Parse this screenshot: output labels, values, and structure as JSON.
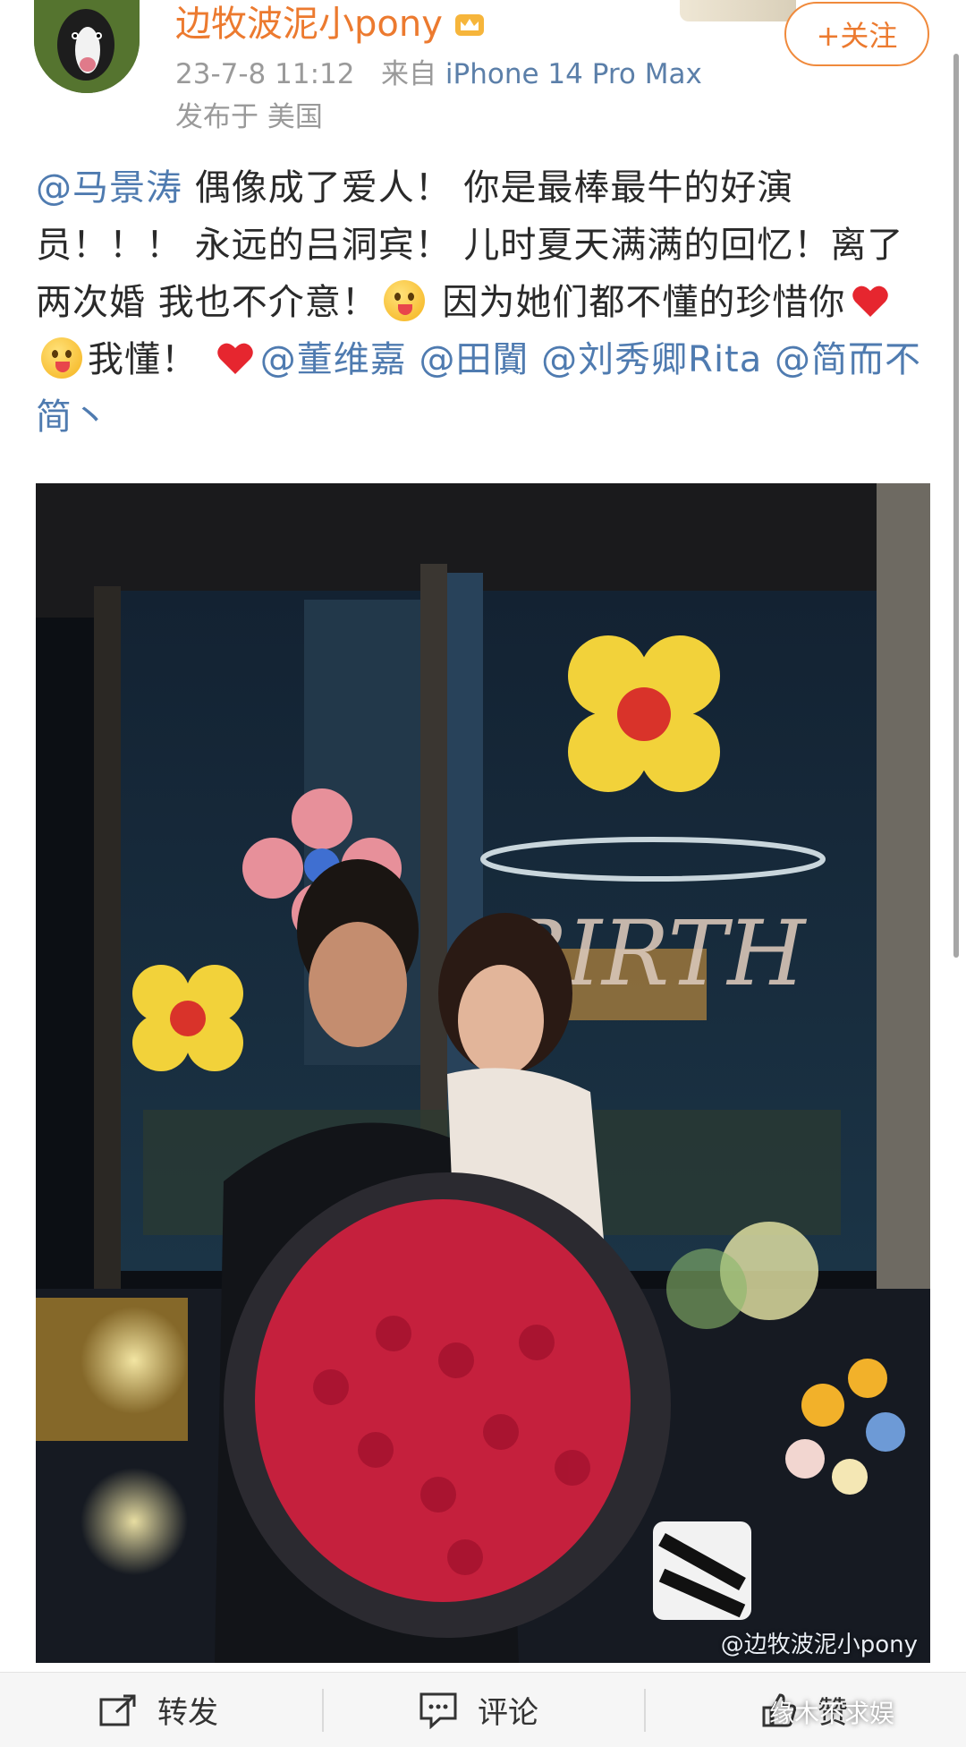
{
  "header": {
    "username": "边牧波泥小pony",
    "timestamp": "23-7-8 11:12",
    "source_prefix": "来自",
    "device": "iPhone 14 Pro Max",
    "location": "发布于 美国",
    "follow_label": "+关注",
    "crown_icon": "vip-crown-icon"
  },
  "post": {
    "segments": [
      {
        "type": "mention",
        "text": "@马景涛"
      },
      {
        "type": "text",
        "text": " 偶像成了爱人！ 你是最棒最牛的好演员！！！ 永远的吕洞宾！ 儿时夏天满满的回忆！离了两次婚 我也不介意！"
      },
      {
        "type": "emoji",
        "name": "tongue-wink-emoji"
      },
      {
        "type": "text",
        "text": " 因为她们都不懂的珍惜你"
      },
      {
        "type": "heart",
        "name": "red-heart-emoji"
      },
      {
        "type": "emoji",
        "name": "tongue-wink-emoji"
      },
      {
        "type": "text",
        "text": "我懂！ "
      },
      {
        "type": "heart",
        "name": "red-heart-emoji"
      },
      {
        "type": "mention",
        "text": "@董维嘉"
      },
      {
        "type": "text",
        "text": " "
      },
      {
        "type": "mention",
        "text": "@田闐"
      },
      {
        "type": "text",
        "text": " "
      },
      {
        "type": "mention",
        "text": "@刘秀卿Rita"
      },
      {
        "type": "text",
        "text": " "
      },
      {
        "type": "mention",
        "text": "@简而不简丶"
      }
    ]
  },
  "photo": {
    "watermark": "@边牧波泥小pony",
    "balloon_letters": "BIRTH"
  },
  "actions": {
    "repost_label": "转发",
    "comment_label": "评论",
    "like_label": "赞"
  },
  "overlay_watermark": "缘木不求娱",
  "colors": {
    "username": "#ec7a2f",
    "mention": "#4f7bb0",
    "meta": "#9a9a9a",
    "follow_border": "#f08a3c"
  }
}
